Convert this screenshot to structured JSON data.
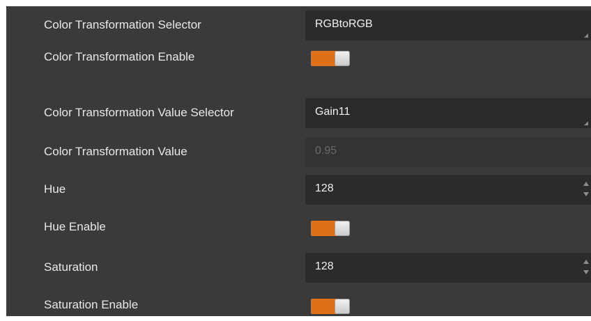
{
  "rows": [
    {
      "label": "Color Transformation Selector",
      "type": "dropdown",
      "value": "RGBtoRGB"
    },
    {
      "label": "Color Transformation Enable",
      "type": "toggle",
      "on": true
    },
    {
      "label": "Color Transformation Value Selector",
      "type": "dropdown",
      "value": "Gain11"
    },
    {
      "label": "Color Transformation Value",
      "type": "readonly",
      "value": "0.95"
    },
    {
      "label": "Hue",
      "type": "spinbox",
      "value": "128"
    },
    {
      "label": "Hue Enable",
      "type": "toggle",
      "on": true
    },
    {
      "label": "Saturation",
      "type": "spinbox",
      "value": "128"
    },
    {
      "label": "Saturation Enable",
      "type": "toggle",
      "on": true
    }
  ],
  "colors": {
    "panel_bg": "#3a3a3b",
    "field_bg": "#2b2b2c",
    "toggle_on": "#e07018",
    "disabled_text": "#6b6b6b"
  },
  "icons": {
    "dropdown": "dropdown-corner-icon",
    "spinbox": "spin-arrows-icon"
  }
}
